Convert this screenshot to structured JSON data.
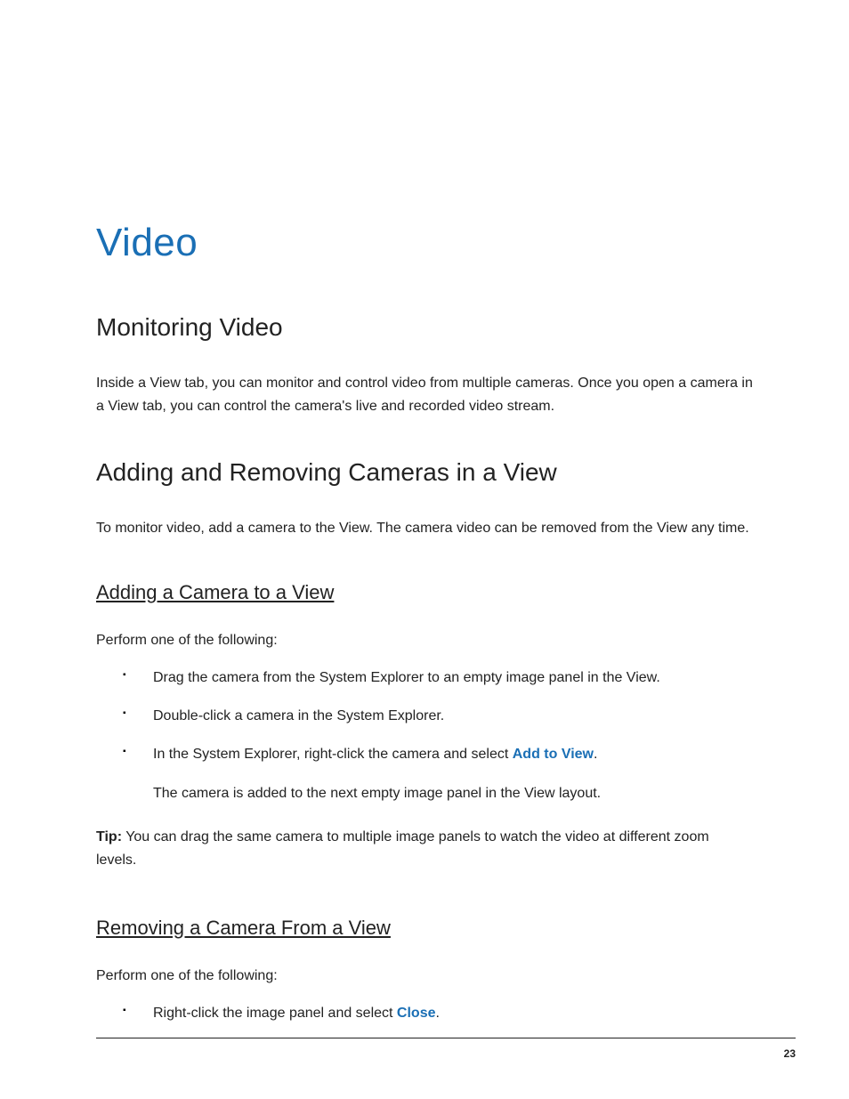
{
  "title": "Video",
  "section_monitoring": {
    "heading": "Monitoring Video",
    "para": "Inside a View tab, you can monitor and control video from multiple cameras. Once you open a camera in a View tab, you can control the camera's live and recorded video stream."
  },
  "section_adding_removing": {
    "heading": "Adding and Removing Cameras in a View",
    "para": "To monitor video, add a camera to the View. The camera video can be removed from the View any time."
  },
  "sub_adding": {
    "heading": "Adding a Camera to a View",
    "intro": "Perform one of the following:",
    "bullets": {
      "b1": "Drag the camera from the System Explorer to an empty image panel in the View.",
      "b2": "Double-click a camera in the System Explorer.",
      "b3_pre": "In the System Explorer, right-click the camera and select ",
      "b3_link": "Add to View",
      "b3_post": "."
    },
    "after_bullets": "The camera is added to the next empty image panel in the View layout.",
    "tip_label": "Tip:",
    "tip_text": "   You can drag the same camera to multiple image panels to watch the video at different zoom levels."
  },
  "sub_removing": {
    "heading": "Removing a Camera From a View",
    "intro": "Perform one of the following:",
    "bullets": {
      "b1_pre": "Right-click the image panel and select ",
      "b1_link": "Close",
      "b1_post": "."
    }
  },
  "page_number": "23"
}
